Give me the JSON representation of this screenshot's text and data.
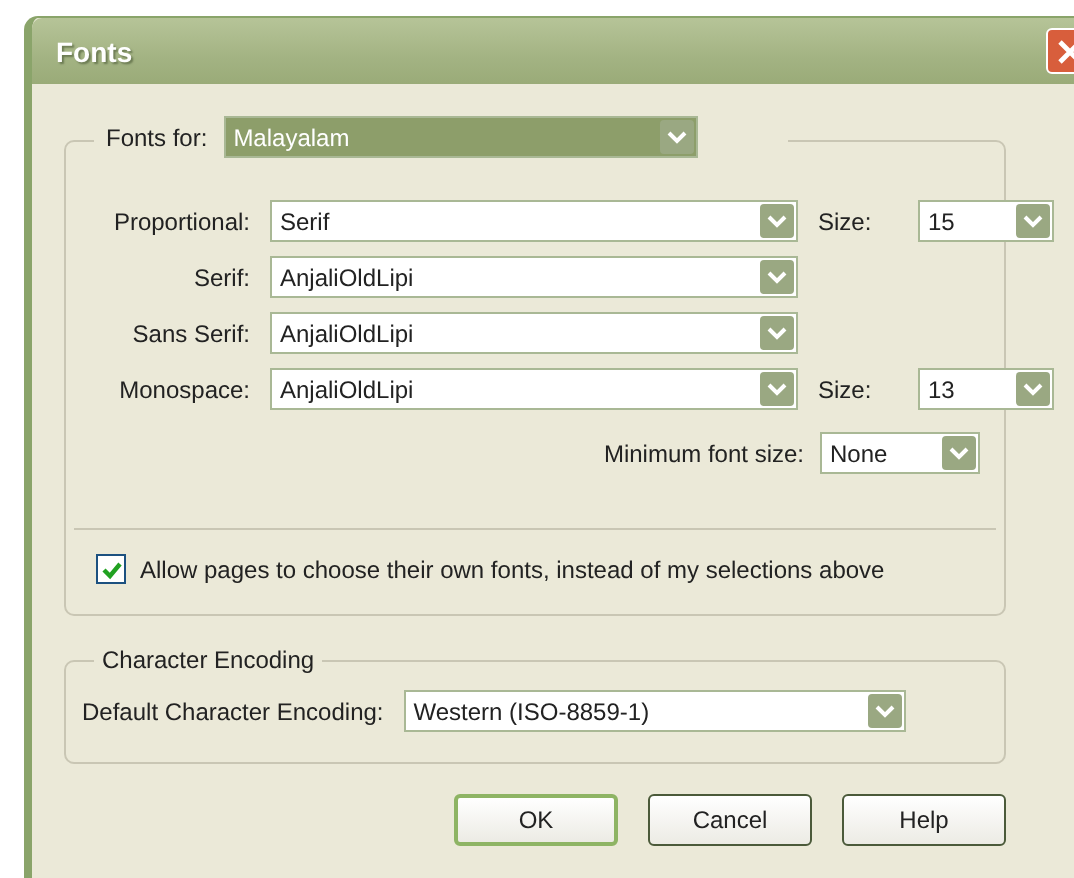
{
  "window": {
    "title": "Fonts"
  },
  "fonts_for": {
    "label": "Fonts for:",
    "value": "Malayalam",
    "focused": true
  },
  "font_rows": [
    {
      "label": "Proportional:",
      "value": "Serif",
      "size": {
        "label": "Size:",
        "value": "15"
      }
    },
    {
      "label": "Serif:",
      "value": "AnjaliOldLipi"
    },
    {
      "label": "Sans Serif:",
      "value": "AnjaliOldLipi"
    },
    {
      "label": "Monospace:",
      "value": "AnjaliOldLipi",
      "size": {
        "label": "Size:",
        "value": "13"
      }
    }
  ],
  "minimum_size": {
    "label": "Minimum font size:",
    "value": "None"
  },
  "allow_pages": {
    "label": "Allow pages to choose their own fonts, instead of my selections above",
    "checked": true
  },
  "encoding": {
    "legend": "Character Encoding",
    "label": "Default Character Encoding:",
    "value": "Western (ISO-8859-1)"
  },
  "buttons": [
    {
      "label": "OK",
      "default": true
    },
    {
      "label": "Cancel",
      "default": false
    },
    {
      "label": "Help",
      "default": false
    }
  ]
}
